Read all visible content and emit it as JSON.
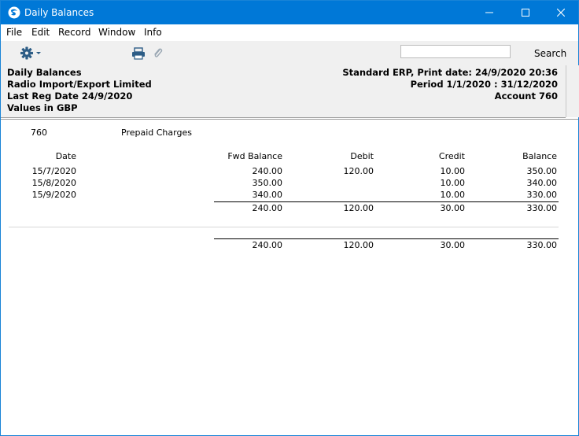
{
  "window": {
    "title": "Daily Balances"
  },
  "menu": [
    "File",
    "Edit",
    "Record",
    "Window",
    "Info"
  ],
  "toolbar": {
    "search_label": "Search",
    "search_value": ""
  },
  "header": {
    "report_name": "Daily Balances",
    "company": "Radio Import/Export Limited",
    "last_reg_date": "Last Reg Date  24/9/2020",
    "currency_note": "Values in GBP",
    "system_print": "Standard ERP, Print date: 24/9/2020 20:36",
    "period": "Period   1/1/2020 : 31/12/2020",
    "account": "Account   760"
  },
  "report": {
    "account_number": "760",
    "account_name": "Prepaid Charges",
    "columns": [
      "Date",
      "Fwd Balance",
      "Debit",
      "Credit",
      "Balance"
    ],
    "rows": [
      {
        "date": "15/7/2020",
        "fwd": "240.00",
        "debit": "120.00",
        "credit": "10.00",
        "balance": "350.00"
      },
      {
        "date": "15/8/2020",
        "fwd": "350.00",
        "debit": "",
        "credit": "10.00",
        "balance": "340.00"
      },
      {
        "date": "15/9/2020",
        "fwd": "340.00",
        "debit": "",
        "credit": "10.00",
        "balance": "330.00"
      }
    ],
    "subtotal": {
      "fwd": "240.00",
      "debit": "120.00",
      "credit": "30.00",
      "balance": "330.00"
    },
    "grand_total": {
      "fwd": "240.00",
      "debit": "120.00",
      "credit": "30.00",
      "balance": "330.00"
    }
  }
}
